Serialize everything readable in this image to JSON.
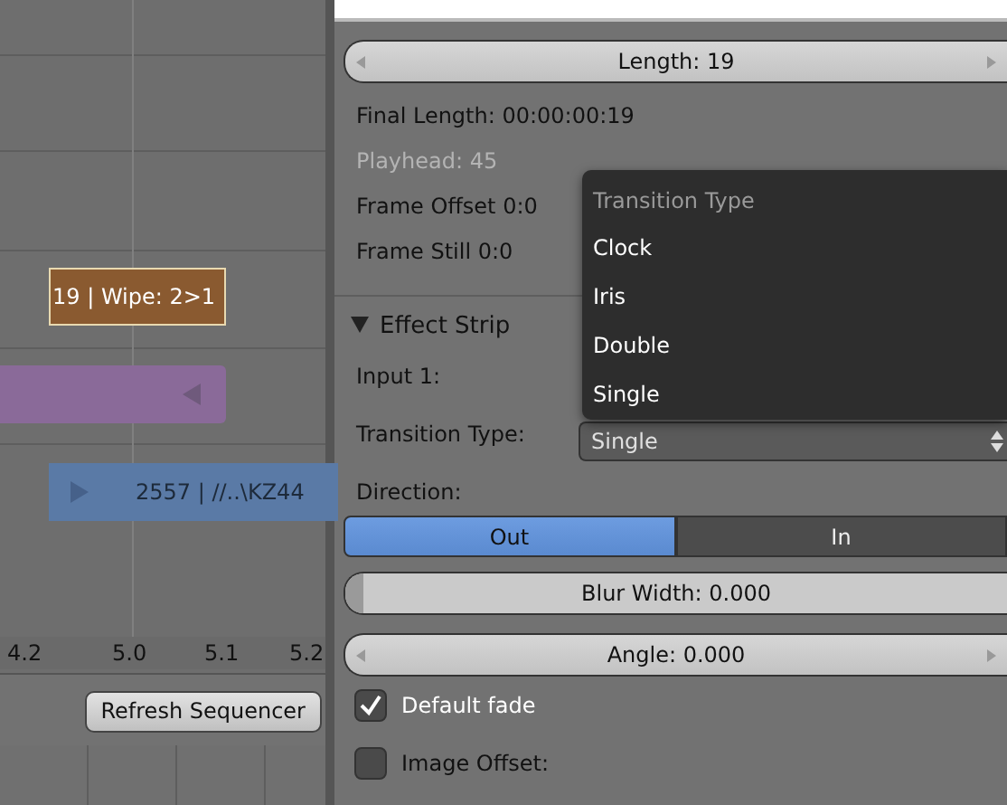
{
  "timeline": {
    "strips": [
      {
        "kind": "effect",
        "label": "19 | Wipe: 2>1",
        "color": "#8a5a30"
      },
      {
        "kind": "meta",
        "color": "#8a6a99"
      },
      {
        "kind": "image",
        "label": "2557 | //..\\KZ44",
        "color": "#5a7aa6"
      }
    ],
    "ruler": [
      "4.2",
      "5.0",
      "5.1",
      "5.2"
    ],
    "refresh_button": "Refresh Sequencer"
  },
  "panel": {
    "length": "Length: 19",
    "final_length": "Final Length: 00:00:00:19",
    "playhead": "Playhead: 45",
    "frame_offset": "Frame Offset 0:0",
    "frame_still": "Frame Still 0:0",
    "section": {
      "title": "Effect Strip",
      "expanded": true
    },
    "input_label": "Input 1:",
    "transition_label": "Transition Type:",
    "transition_value": "Single",
    "direction_label": "Direction:",
    "direction": [
      {
        "label": "Out",
        "selected": true
      },
      {
        "label": "In",
        "selected": false
      }
    ],
    "blur_width": {
      "label": "Blur Width: 0.000",
      "level": 0.0
    },
    "angle": "Angle: 0.000",
    "checkboxes": [
      {
        "label": "Default fade",
        "checked": true
      },
      {
        "label": "Image Offset:",
        "checked": false
      }
    ]
  },
  "menu": {
    "title": "Transition Type",
    "items": [
      "Clock",
      "Iris",
      "Double",
      "Single"
    ]
  }
}
